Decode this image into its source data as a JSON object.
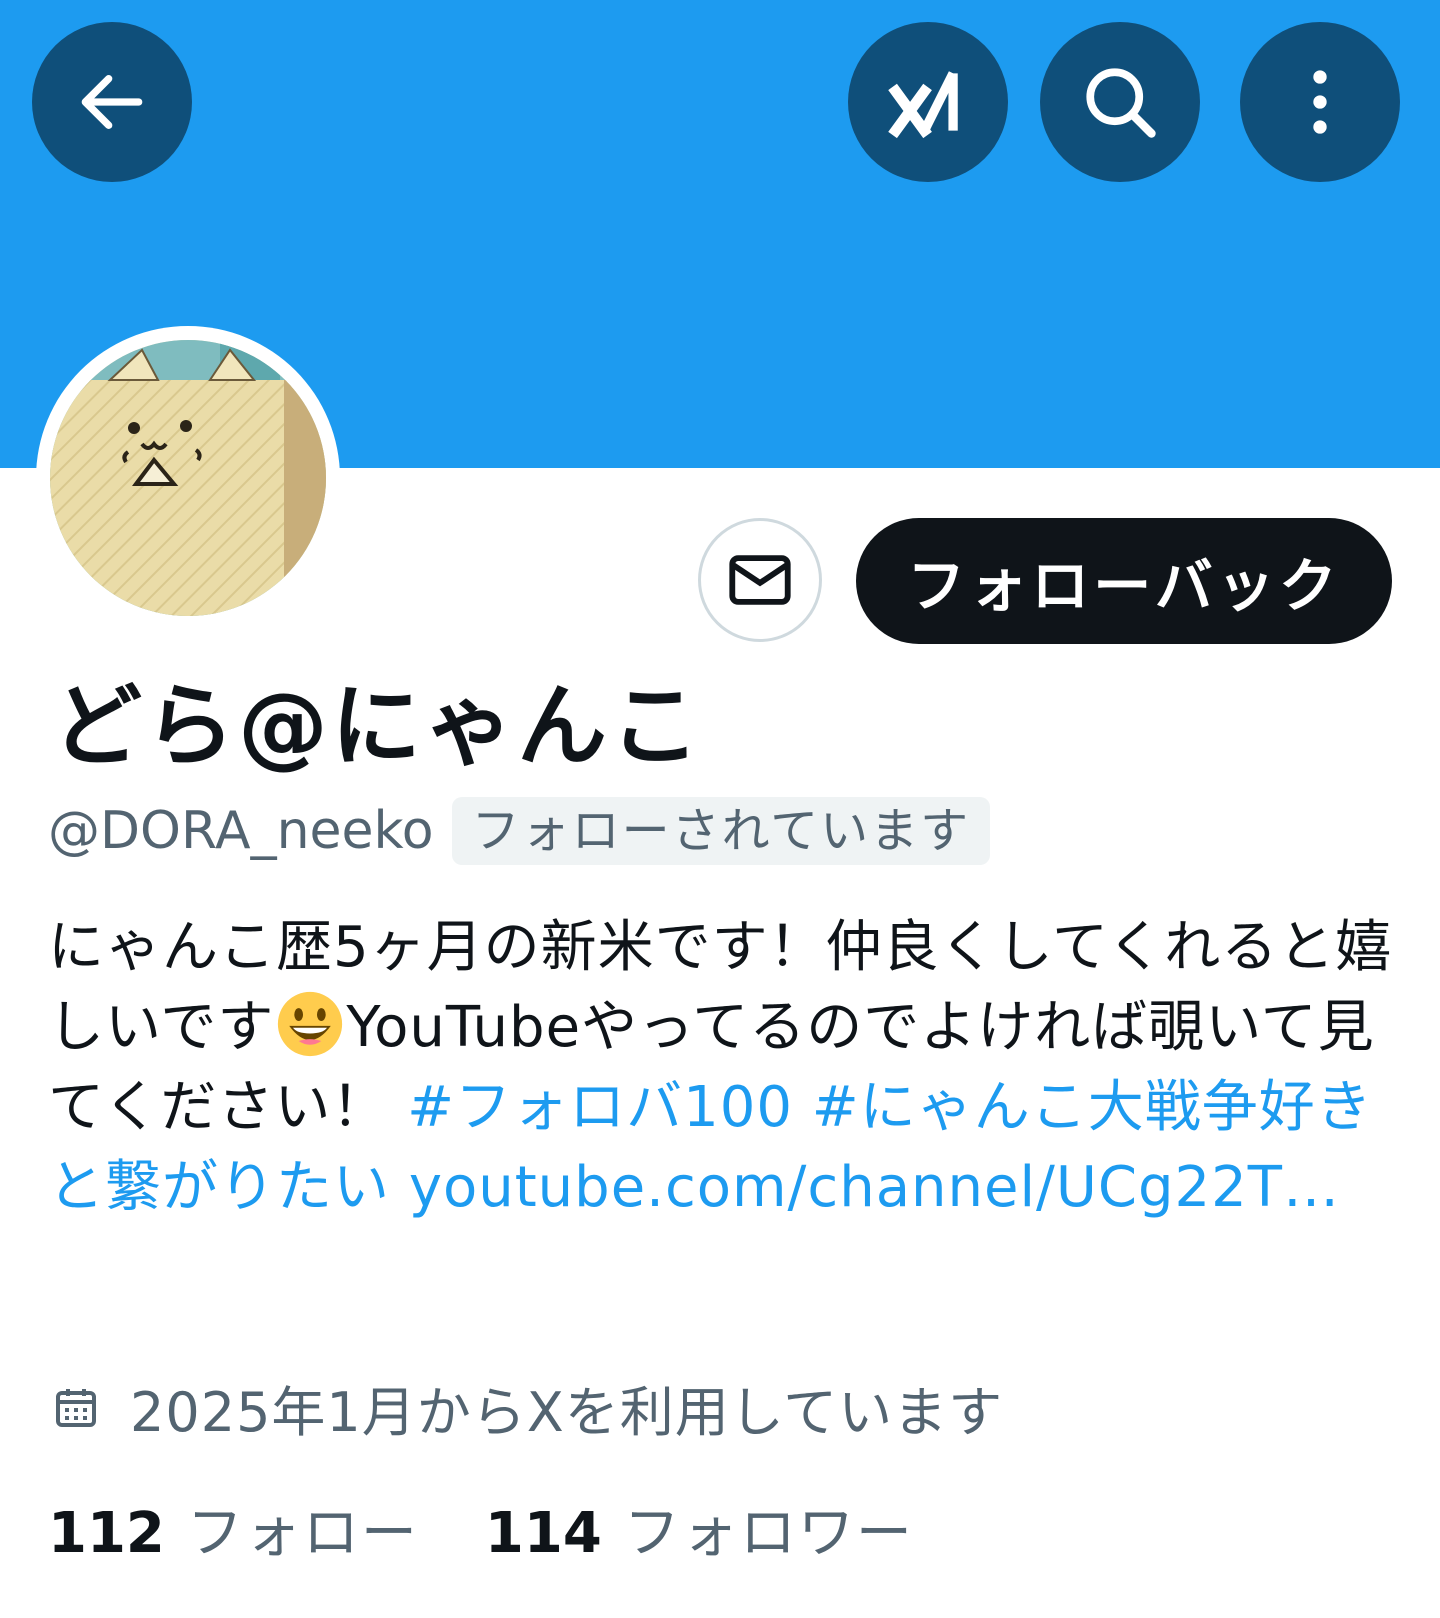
{
  "header": {
    "back_icon": "arrow-left-icon",
    "grok_icon": "grok-icon",
    "search_icon": "search-icon",
    "more_icon": "more-vertical-icon",
    "banner_color": "#1d9bf0",
    "button_color": "#0f4f7a"
  },
  "profile": {
    "display_name": "どら@にゃんこ",
    "handle": "@DORA_neeko",
    "follows_you_badge": "フォローされています",
    "message_icon": "envelope-icon",
    "follow_back_label": "フォローバック"
  },
  "bio": {
    "text_1": "にゃんこ歴5ヶ月の新米です！仲良くしてくれると嬉しいです",
    "emoji": "grinning-face-emoji",
    "text_2": "YouTubeやってるのでよければ覗いて見てください！",
    "hashtag_1": "#フォロバ100",
    "hashtag_2": "#にゃんこ大戦争好きと繋がりたい",
    "link": "youtube.com/channel/UCg22T…",
    "link_color": "#1d9bf0"
  },
  "joined": {
    "icon": "calendar-icon",
    "text": "2025年1月からXを利用しています"
  },
  "stats": {
    "following_count": "112",
    "following_label": "フォロー",
    "followers_count": "114",
    "followers_label": "フォロワー"
  }
}
